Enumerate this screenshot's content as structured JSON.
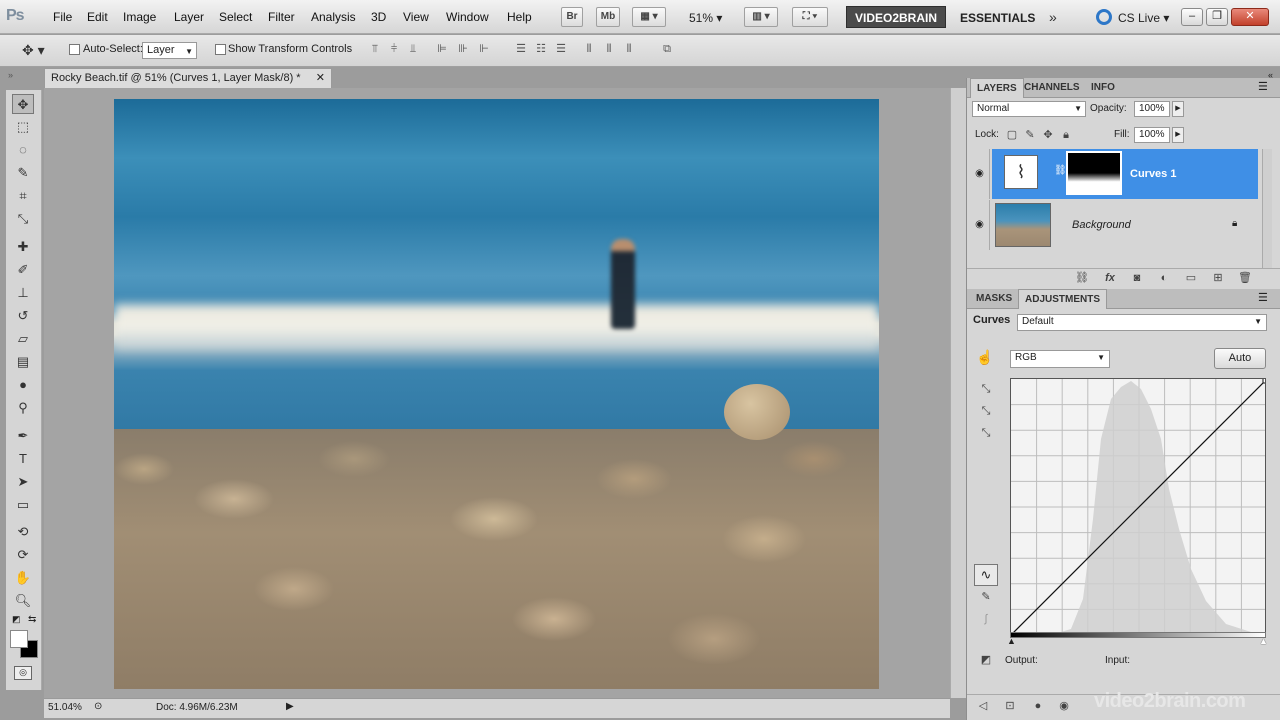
{
  "app": {
    "logo": "Ps"
  },
  "menus": [
    "File",
    "Edit",
    "Image",
    "Layer",
    "Select",
    "Filter",
    "Analysis",
    "3D",
    "View",
    "Window",
    "Help"
  ],
  "menubar_buttons": {
    "bridge": "Br",
    "minibridge": "Mb",
    "zoom": "51%",
    "workspace_brand": "VIDEO2BRAIN",
    "workspace": "ESSENTIALS",
    "cslive": "CS Live"
  },
  "options_bar": {
    "auto_select_label": "Auto-Select:",
    "auto_select_value": "Layer",
    "transform_label": "Show Transform Controls"
  },
  "document": {
    "tab_title": "Rocky Beach.tif @ 51% (Curves 1, Layer Mask/8) *",
    "zoom": "51.04%",
    "doc_info": "Doc: 4.96M/6.23M"
  },
  "layers_panel": {
    "tabs": [
      "LAYERS",
      "CHANNELS",
      "INFO"
    ],
    "blend_mode": "Normal",
    "opacity_label": "Opacity:",
    "opacity": "100%",
    "lock_label": "Lock:",
    "fill_label": "Fill:",
    "fill": "100%",
    "layers": [
      {
        "name": "Curves 1",
        "selected": true
      },
      {
        "name": "Background",
        "selected": false,
        "locked": true
      }
    ]
  },
  "adjustments_panel": {
    "tabs": [
      "MASKS",
      "ADJUSTMENTS"
    ],
    "title": "Curves",
    "preset": "Default",
    "channel": "RGB",
    "auto_label": "Auto",
    "output_label": "Output:",
    "input_label": "Input:"
  },
  "watermark": "video2brain.com",
  "colors": {
    "selection": "#3f8fe6",
    "brand_bg": "#4b4b4b"
  }
}
